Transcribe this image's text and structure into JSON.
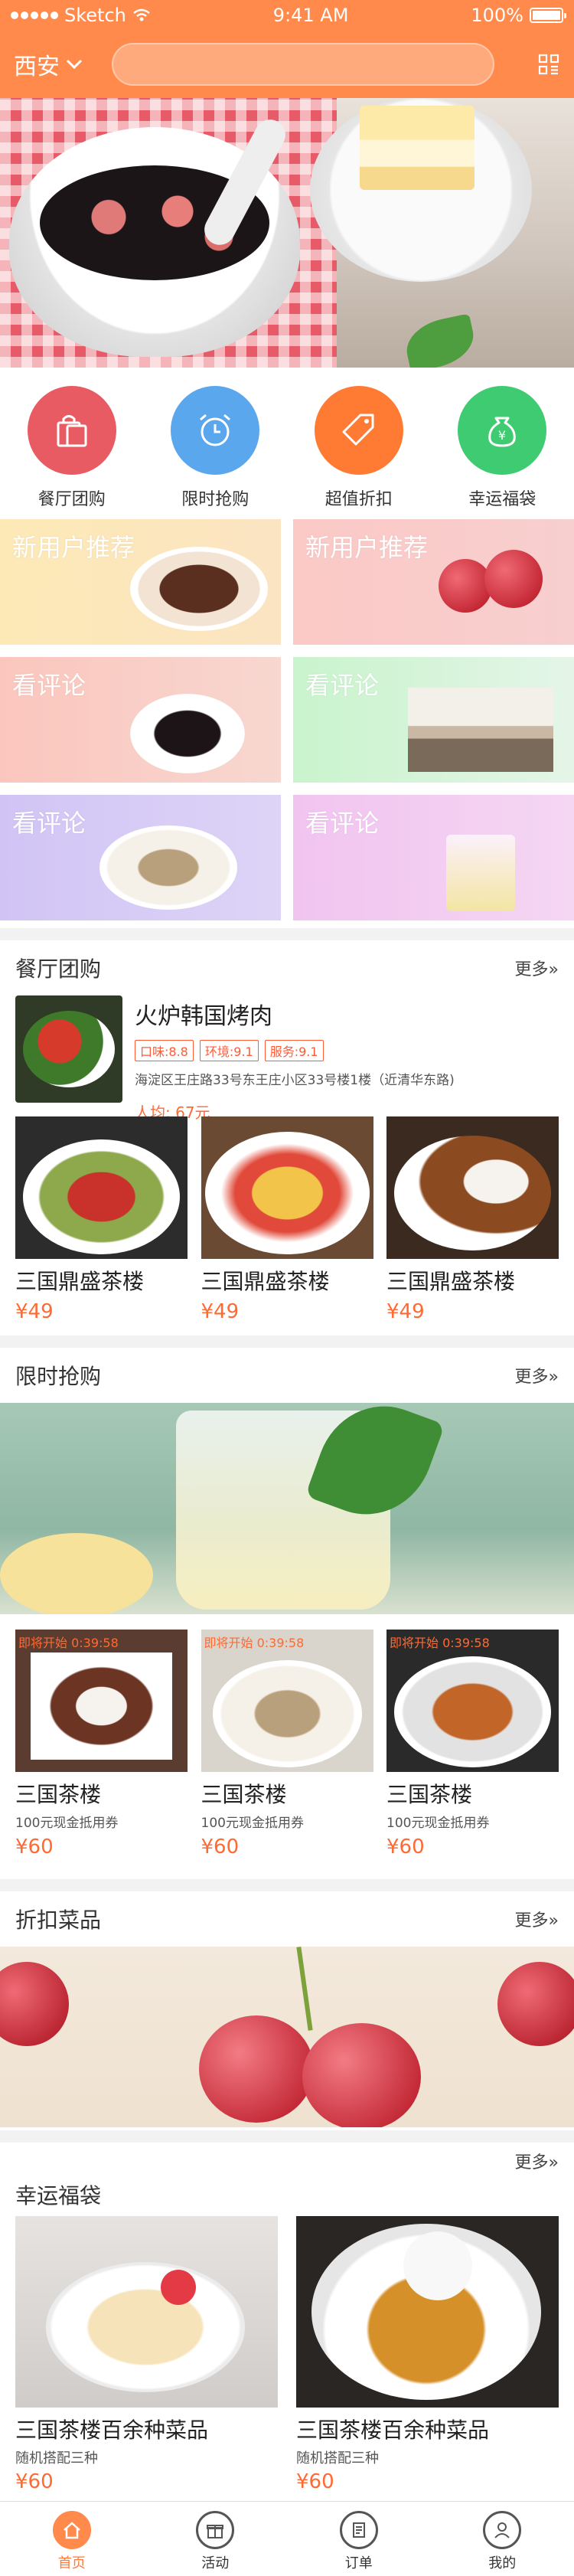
{
  "status": {
    "carrier": "Sketch",
    "time": "9:41 AM",
    "battery": "100%"
  },
  "header": {
    "city": "西安",
    "search_placeholder": ""
  },
  "categories": [
    {
      "label": "餐厅团购",
      "icon": "shopping-bag-icon",
      "color": "#e85b62"
    },
    {
      "label": "限时抢购",
      "icon": "alarm-clock-icon",
      "color": "#5aa7ee"
    },
    {
      "label": "超值折扣",
      "icon": "price-tag-icon",
      "color": "#ff7a33"
    },
    {
      "label": "幸运福袋",
      "icon": "money-bag-icon",
      "color": "#3ecb72"
    }
  ],
  "tiles": [
    {
      "title": "新用户推荐",
      "bg": "#fde9b6"
    },
    {
      "title": "新用户推荐",
      "bg": "#fbc9c6"
    },
    {
      "title": "看评论",
      "bg": "#fbc6bd"
    },
    {
      "title": "看评论",
      "bg": "#c9f4cc"
    },
    {
      "title": "看评论",
      "bg": "#d1c4f5"
    },
    {
      "title": "看评论",
      "bg": "#f1c4f0"
    }
  ],
  "group": {
    "title": "餐厅团购",
    "more": "更多»",
    "featured": {
      "name": "火炉韩国烤肉",
      "tags": [
        "口味:8.8",
        "环境:9.1",
        "服务:9.1"
      ],
      "address": "海淀区王庄路33号东王庄小区33号楼1楼（近清华东路)",
      "price": "人均: 67元"
    },
    "items": [
      {
        "name": "三国鼎盛茶楼",
        "price": "¥49"
      },
      {
        "name": "三国鼎盛茶楼",
        "price": "¥49"
      },
      {
        "name": "三国鼎盛茶楼",
        "price": "¥49"
      }
    ]
  },
  "flash": {
    "title": "限时抢购",
    "more": "更多»",
    "items": [
      {
        "badge": "即将开始 0:39:58",
        "name": "三国茶楼",
        "desc": "100元现金抵用券",
        "price": "¥60"
      },
      {
        "badge": "即将开始 0:39:58",
        "name": "三国茶楼",
        "desc": "100元现金抵用券",
        "price": "¥60"
      },
      {
        "badge": "即将开始 0:39:58",
        "name": "三国茶楼",
        "desc": "100元现金抵用券",
        "price": "¥60"
      }
    ]
  },
  "discount": {
    "title": "折扣菜品",
    "more": "更多»"
  },
  "lucky": {
    "title": "幸运福袋",
    "more": "更多»",
    "items": [
      {
        "name": "三国茶楼百余种菜品",
        "desc": "随机搭配三种",
        "price": "¥60"
      },
      {
        "name": "三国茶楼百余种菜品",
        "desc": "随机搭配三种",
        "price": "¥60"
      }
    ]
  },
  "tabs": [
    {
      "label": "首页",
      "icon": "home-icon",
      "active": true
    },
    {
      "label": "活动",
      "icon": "gift-icon",
      "active": false
    },
    {
      "label": "订单",
      "icon": "order-list-icon",
      "active": false
    },
    {
      "label": "我的",
      "icon": "user-icon",
      "active": false
    }
  ]
}
